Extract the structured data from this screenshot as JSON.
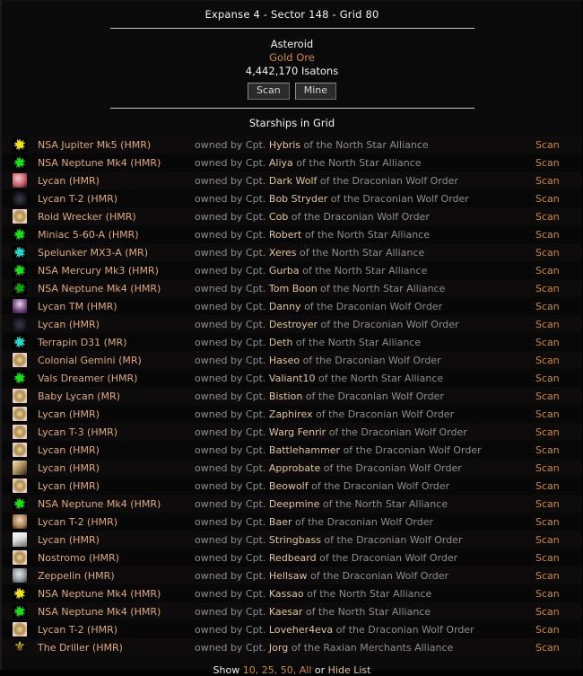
{
  "header": {
    "grid_title": "Expanse 4 - Sector 148 - Grid 80"
  },
  "object": {
    "name": "Asteroid",
    "resource": "Gold Ore",
    "quantity": "4,442,170 Isatons",
    "scan_label": "Scan",
    "mine_label": "Mine"
  },
  "list": {
    "section_title": "Starships in Grid",
    "owner_prefix": "owned by Cpt.",
    "scan_label": "Scan",
    "rows": [
      {
        "icon": "star-yellow-icon",
        "ship": "NSA Jupiter Mk5 (HMR)",
        "captain": "Hybris",
        "faction": "of the North Star Alliance"
      },
      {
        "icon": "star-green-icon",
        "ship": "NSA Neptune Mk4 (HMR)",
        "captain": "Aliya",
        "faction": "of the North Star Alliance"
      },
      {
        "icon": "avatar-pink-icon",
        "ship": "Lycan (HMR)",
        "captain": "Dark Wolf",
        "faction": "of the Draconian Wolf Order"
      },
      {
        "icon": "avatar-dark-icon",
        "ship": "Lycan T-2 (HMR)",
        "captain": "Bob Stryder",
        "faction": "of the Draconian Wolf Order"
      },
      {
        "icon": "avatar-crest-icon",
        "ship": "Roid Wrecker (HMR)",
        "captain": "Cob",
        "faction": "of the Draconian Wolf Order"
      },
      {
        "icon": "star-green-icon",
        "ship": "Miniac 5-60-A (HMR)",
        "captain": "Robert",
        "faction": "of the North Star Alliance"
      },
      {
        "icon": "star-teal-icon",
        "ship": "Spelunker MX3-A (MR)",
        "captain": "Xeres",
        "faction": "of the North Star Alliance"
      },
      {
        "icon": "star-green-icon",
        "ship": "NSA Mercury Mk3 (HMR)",
        "captain": "Gurba",
        "faction": "of the North Star Alliance"
      },
      {
        "icon": "star-dgreen-icon",
        "ship": "NSA Neptune Mk4 (HMR)",
        "captain": "Tom Boon",
        "faction": "of the North Star Alliance"
      },
      {
        "icon": "avatar-purple-icon",
        "ship": "Lycan TM (HMR)",
        "captain": "Danny",
        "faction": "of the Draconian Wolf Order"
      },
      {
        "icon": "avatar-dark-icon",
        "ship": "Lycan (HMR)",
        "captain": "Destroyer",
        "faction": "of the Draconian Wolf Order"
      },
      {
        "icon": "star-teal-icon",
        "ship": "Terrapin D31 (MR)",
        "captain": "Deth",
        "faction": "of the North Star Alliance"
      },
      {
        "icon": "avatar-crest-icon",
        "ship": "Colonial Gemini (MR)",
        "captain": "Haseo",
        "faction": "of the Draconian Wolf Order"
      },
      {
        "icon": "star-green-icon",
        "ship": "Vals Dreamer (HMR)",
        "captain": "Valiant10",
        "faction": "of the North Star Alliance"
      },
      {
        "icon": "avatar-crest-icon",
        "ship": "Baby Lycan (MR)",
        "captain": "Bistion",
        "faction": "of the Draconian Wolf Order"
      },
      {
        "icon": "avatar-crest-icon",
        "ship": "Lycan (HMR)",
        "captain": "Zaphirex",
        "faction": "of the Draconian Wolf Order"
      },
      {
        "icon": "avatar-crest-icon",
        "ship": "Lycan T-3 (HMR)",
        "captain": "Warg Fenrir",
        "faction": "of the Draconian Wolf Order"
      },
      {
        "icon": "avatar-crest-icon",
        "ship": "Lycan (HMR)",
        "captain": "Battlehammer",
        "faction": "of the Draconian Wolf Order"
      },
      {
        "icon": "avatar-wolf-icon",
        "ship": "Lycan (HMR)",
        "captain": "Approbate",
        "faction": "of the Draconian Wolf Order"
      },
      {
        "icon": "avatar-crest-icon",
        "ship": "Lycan (HMR)",
        "captain": "Beowolf",
        "faction": "of the Draconian Wolf Order"
      },
      {
        "icon": "star-green-icon",
        "ship": "NSA Neptune Mk4 (HMR)",
        "captain": "Deepmine",
        "faction": "of the North Star Alliance"
      },
      {
        "icon": "avatar-face-icon",
        "ship": "Lycan T-2 (HMR)",
        "captain": "Baer",
        "faction": "of the Draconian Wolf Order"
      },
      {
        "icon": "avatar-bird-icon",
        "ship": "Lycan (HMR)",
        "captain": "Stringbass",
        "faction": "of the Draconian Wolf Order"
      },
      {
        "icon": "avatar-crest-icon",
        "ship": "Nostromo (HMR)",
        "captain": "Redbeard",
        "faction": "of the Draconian Wolf Order"
      },
      {
        "icon": "avatar-gray-icon",
        "ship": "Zeppelin (HMR)",
        "captain": "Hellsaw",
        "faction": "of the Draconian Wolf Order"
      },
      {
        "icon": "star-yellow-icon",
        "ship": "NSA Neptune Mk4 (HMR)",
        "captain": "Kassao",
        "faction": "of the North Star Alliance"
      },
      {
        "icon": "star-green-icon",
        "ship": "NSA Neptune Mk4 (HMR)",
        "captain": "Kaesar",
        "faction": "of the North Star Alliance"
      },
      {
        "icon": "avatar-crest-icon",
        "ship": "Lycan T-2 (HMR)",
        "captain": "Loveher4eva",
        "faction": "of the Draconian Wolf Order"
      },
      {
        "icon": "avatar-fleur-icon",
        "ship": "The Driller (HMR)",
        "captain": "Jorg",
        "faction": "of the Raxian Merchants Alliance"
      }
    ]
  },
  "footer": {
    "show_label": "Show",
    "option_10": "10,",
    "option_25": "25,",
    "option_50": "50,",
    "option_all": "All",
    "or_label": "or",
    "hide_label": "Hide List"
  },
  "colors": {
    "background": "#0a0a0a",
    "accent_orange": "#cf8a3c",
    "ship_name": "#dfa97f",
    "captain": "#e2c49c",
    "faction": "#8e8e8e",
    "heading": "#f2f2f2"
  }
}
